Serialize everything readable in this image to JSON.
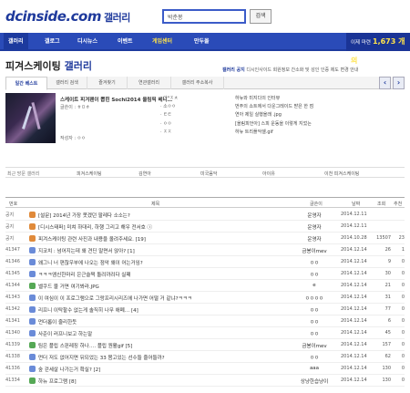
{
  "header": {
    "logo": "dcinside.com",
    "logo_sub": "갤러리",
    "search_value": "박춘봉",
    "search_button": "검색"
  },
  "nav": {
    "items": [
      "갤러리",
      "갤로그",
      "디시뉴스",
      "이벤트",
      "게임센터",
      "만두몰"
    ],
    "right_label": "이제 마련",
    "right_count": "1,673 개의"
  },
  "gallery": {
    "title": "피겨스케이팅",
    "title_suffix": "갤러리",
    "menu_bold": "갤러리 공지",
    "menu_rest": "디시인사이드 회원정보 간소화 및 성인 인증 제도 변경 안내"
  },
  "tabs": [
    "일간 베스트",
    "갤러리 검색",
    "즐겨찾기",
    "연관갤러리",
    "갤러리 주소복사"
  ],
  "arrows": {
    "left": "‹",
    "right": "›"
  },
  "featured": {
    "title": "스케이트 피겨팬이 뽑힌 Sochi2014 올림픽 베니…",
    "author": "글쓴이 : ㅎㅁㅎ",
    "meta": "작성자 : ㅇㅇ",
    "list": [
      "· 아*ㅈㅊ",
      "· 소ㅇㅇ",
      "· ㅌㅌ",
      "· ㅇㅇ",
      "· ㅈㅈ"
    ],
    "list2": [
      "하뉴와 미지다의 인터뷰",
      "번주의 쇼트에서 다운그레이드 받은 한 점",
      "연아 제일 실행올래 .jpg",
      "[올림피언아] 스피 운동을 이렇게 지었는",
      "하뉴 트리플악셀.gif"
    ]
  },
  "related": {
    "label": "최근 방문 갤러리",
    "items": [
      "피겨스케이팅",
      "김연아",
      "미국음악",
      "아이유",
      "이천 피겨스케이팅"
    ]
  },
  "table": {
    "headers": {
      "num": "번호",
      "title": "제목",
      "writer": "글쓴이",
      "date": "날짜",
      "views": "조회",
      "recommend": "추천"
    },
    "rows": [
      {
        "num": "공지",
        "title": "[설문] 2014년 가장 못겠던 팔레다 소소는?",
        "writer": "운영자",
        "date": "2014.12.11",
        "views": "",
        "rec": "",
        "icon": "n"
      },
      {
        "num": "공지",
        "title": "[디시스태퍼] 미쳐 하대리, 하행 그리고 해우 전서호 ⓘ",
        "writer": "운영자",
        "date": "2014.12.11",
        "views": "",
        "rec": "",
        "icon": "n"
      },
      {
        "num": "공지",
        "title": "피겨스케이팅 관련 사진과 내용을 올려주세요. [19]",
        "writer": "운영자",
        "date": "2014.10.28",
        "views": "13507",
        "rec": "23",
        "icon": "n"
      },
      {
        "num": "41347",
        "title": "지코치 : 넘어지는데 왜 견딘 말면서 앉아? [1]",
        "writer": "금봉이mev",
        "date": "2014.12.14",
        "views": "26",
        "rec": "1",
        "icon": "b"
      },
      {
        "num": "41346",
        "title": "왜그니 너 편찮우부에 나오는 점악 왜이 어는거임?",
        "writer": "ㅇㅇ",
        "date": "2014.12.14",
        "views": "9",
        "rec": "0",
        "icon": "b"
      },
      {
        "num": "41345",
        "title": "ㅋㅋㅋ엠신한마리 은근슬쩍 돌려까려다 실패",
        "writer": "ㅇㅇ",
        "date": "2014.12.14",
        "views": "30",
        "rec": "0",
        "icon": "b"
      },
      {
        "num": "41344",
        "title": "벨쿠드 물 거면 여기봐라.JPG",
        "writer": "e",
        "date": "2014.12.14",
        "views": "21",
        "rec": "0",
        "icon": "p"
      },
      {
        "num": "41343",
        "title": "이 여심이 이 프로그램으로 그랑프리시리즈에 나가면 어떨 거 같냐?ㅋㅋㅋ",
        "writer": "ㅇㅇㅇㅇ",
        "date": "2014.12.14",
        "views": "31",
        "rec": "0",
        "icon": "b"
      },
      {
        "num": "41342",
        "title": "리프니 이탁할수 없는게 솔직히 나무 애폐… [4]",
        "writer": "ㅇㅇ",
        "date": "2014.12.14",
        "views": "77",
        "rec": "0",
        "icon": "b"
      },
      {
        "num": "41341",
        "title": "먼더롭이 줄리한듯",
        "writer": "ㅇㅇ",
        "date": "2014.12.14",
        "views": "6",
        "rec": "0",
        "icon": "b"
      },
      {
        "num": "41340",
        "title": "사준이 러프니보고 하는말",
        "writer": "ㅇㅇ",
        "date": "2014.12.14",
        "views": "45",
        "rec": "0",
        "icon": "b"
      },
      {
        "num": "41339",
        "title": "팀은 플립 스핀레징 하나…. 플립 원활gif [5]",
        "writer": "금봉이mev",
        "date": "2014.12.14",
        "views": "157",
        "rec": "0",
        "icon": "p"
      },
      {
        "num": "41338",
        "title": "먼더 저도 없어지면 뒤되었는 33 몸고있는 선수들 줄어들까?",
        "writer": "ㅇㅇ",
        "date": "2014.12.14",
        "views": "62",
        "rec": "0",
        "icon": "b"
      },
      {
        "num": "41336",
        "title": "숲 걷세살 나가는거 확실? [2]",
        "writer": "aaa",
        "date": "2014.12.14",
        "views": "130",
        "rec": "0",
        "icon": "b"
      },
      {
        "num": "41334",
        "title": "하뉴 프로그램 [8]",
        "writer": "상냥한습냥이",
        "date": "2014.12.14",
        "views": "130",
        "rec": "0",
        "icon": "p"
      }
    ]
  }
}
